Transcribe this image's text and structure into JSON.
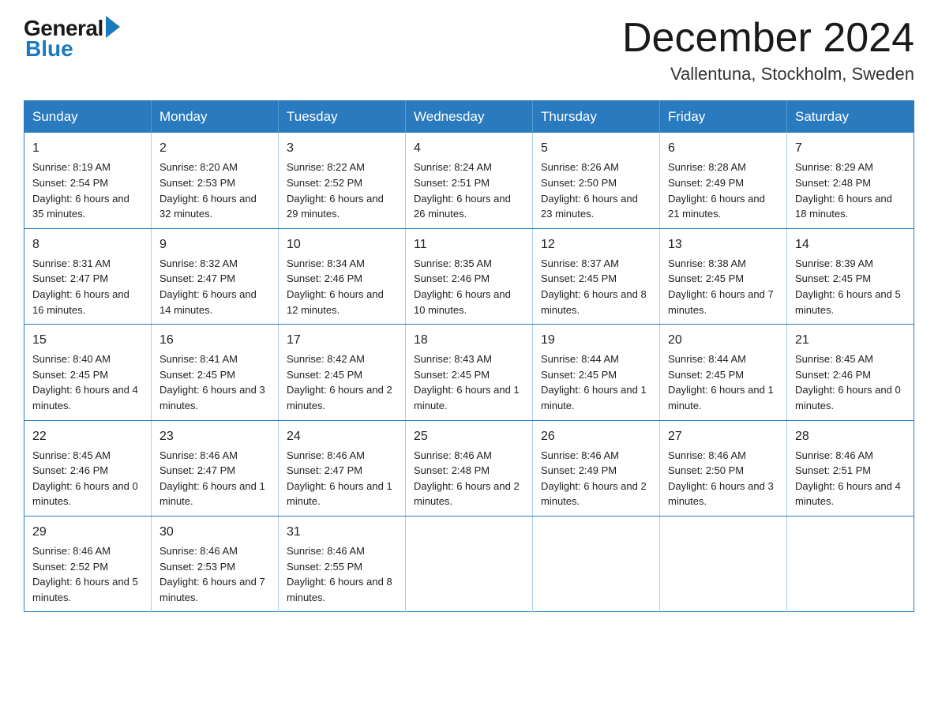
{
  "logo": {
    "general": "General",
    "blue": "Blue"
  },
  "title": "December 2024",
  "location": "Vallentuna, Stockholm, Sweden",
  "headers": [
    "Sunday",
    "Monday",
    "Tuesday",
    "Wednesday",
    "Thursday",
    "Friday",
    "Saturday"
  ],
  "weeks": [
    [
      {
        "day": "1",
        "sunrise": "8:19 AM",
        "sunset": "2:54 PM",
        "daylight": "6 hours and 35 minutes."
      },
      {
        "day": "2",
        "sunrise": "8:20 AM",
        "sunset": "2:53 PM",
        "daylight": "6 hours and 32 minutes."
      },
      {
        "day": "3",
        "sunrise": "8:22 AM",
        "sunset": "2:52 PM",
        "daylight": "6 hours and 29 minutes."
      },
      {
        "day": "4",
        "sunrise": "8:24 AM",
        "sunset": "2:51 PM",
        "daylight": "6 hours and 26 minutes."
      },
      {
        "day": "5",
        "sunrise": "8:26 AM",
        "sunset": "2:50 PM",
        "daylight": "6 hours and 23 minutes."
      },
      {
        "day": "6",
        "sunrise": "8:28 AM",
        "sunset": "2:49 PM",
        "daylight": "6 hours and 21 minutes."
      },
      {
        "day": "7",
        "sunrise": "8:29 AM",
        "sunset": "2:48 PM",
        "daylight": "6 hours and 18 minutes."
      }
    ],
    [
      {
        "day": "8",
        "sunrise": "8:31 AM",
        "sunset": "2:47 PM",
        "daylight": "6 hours and 16 minutes."
      },
      {
        "day": "9",
        "sunrise": "8:32 AM",
        "sunset": "2:47 PM",
        "daylight": "6 hours and 14 minutes."
      },
      {
        "day": "10",
        "sunrise": "8:34 AM",
        "sunset": "2:46 PM",
        "daylight": "6 hours and 12 minutes."
      },
      {
        "day": "11",
        "sunrise": "8:35 AM",
        "sunset": "2:46 PM",
        "daylight": "6 hours and 10 minutes."
      },
      {
        "day": "12",
        "sunrise": "8:37 AM",
        "sunset": "2:45 PM",
        "daylight": "6 hours and 8 minutes."
      },
      {
        "day": "13",
        "sunrise": "8:38 AM",
        "sunset": "2:45 PM",
        "daylight": "6 hours and 7 minutes."
      },
      {
        "day": "14",
        "sunrise": "8:39 AM",
        "sunset": "2:45 PM",
        "daylight": "6 hours and 5 minutes."
      }
    ],
    [
      {
        "day": "15",
        "sunrise": "8:40 AM",
        "sunset": "2:45 PM",
        "daylight": "6 hours and 4 minutes."
      },
      {
        "day": "16",
        "sunrise": "8:41 AM",
        "sunset": "2:45 PM",
        "daylight": "6 hours and 3 minutes."
      },
      {
        "day": "17",
        "sunrise": "8:42 AM",
        "sunset": "2:45 PM",
        "daylight": "6 hours and 2 minutes."
      },
      {
        "day": "18",
        "sunrise": "8:43 AM",
        "sunset": "2:45 PM",
        "daylight": "6 hours and 1 minute."
      },
      {
        "day": "19",
        "sunrise": "8:44 AM",
        "sunset": "2:45 PM",
        "daylight": "6 hours and 1 minute."
      },
      {
        "day": "20",
        "sunrise": "8:44 AM",
        "sunset": "2:45 PM",
        "daylight": "6 hours and 1 minute."
      },
      {
        "day": "21",
        "sunrise": "8:45 AM",
        "sunset": "2:46 PM",
        "daylight": "6 hours and 0 minutes."
      }
    ],
    [
      {
        "day": "22",
        "sunrise": "8:45 AM",
        "sunset": "2:46 PM",
        "daylight": "6 hours and 0 minutes."
      },
      {
        "day": "23",
        "sunrise": "8:46 AM",
        "sunset": "2:47 PM",
        "daylight": "6 hours and 1 minute."
      },
      {
        "day": "24",
        "sunrise": "8:46 AM",
        "sunset": "2:47 PM",
        "daylight": "6 hours and 1 minute."
      },
      {
        "day": "25",
        "sunrise": "8:46 AM",
        "sunset": "2:48 PM",
        "daylight": "6 hours and 2 minutes."
      },
      {
        "day": "26",
        "sunrise": "8:46 AM",
        "sunset": "2:49 PM",
        "daylight": "6 hours and 2 minutes."
      },
      {
        "day": "27",
        "sunrise": "8:46 AM",
        "sunset": "2:50 PM",
        "daylight": "6 hours and 3 minutes."
      },
      {
        "day": "28",
        "sunrise": "8:46 AM",
        "sunset": "2:51 PM",
        "daylight": "6 hours and 4 minutes."
      }
    ],
    [
      {
        "day": "29",
        "sunrise": "8:46 AM",
        "sunset": "2:52 PM",
        "daylight": "6 hours and 5 minutes."
      },
      {
        "day": "30",
        "sunrise": "8:46 AM",
        "sunset": "2:53 PM",
        "daylight": "6 hours and 7 minutes."
      },
      {
        "day": "31",
        "sunrise": "8:46 AM",
        "sunset": "2:55 PM",
        "daylight": "6 hours and 8 minutes."
      },
      null,
      null,
      null,
      null
    ]
  ]
}
